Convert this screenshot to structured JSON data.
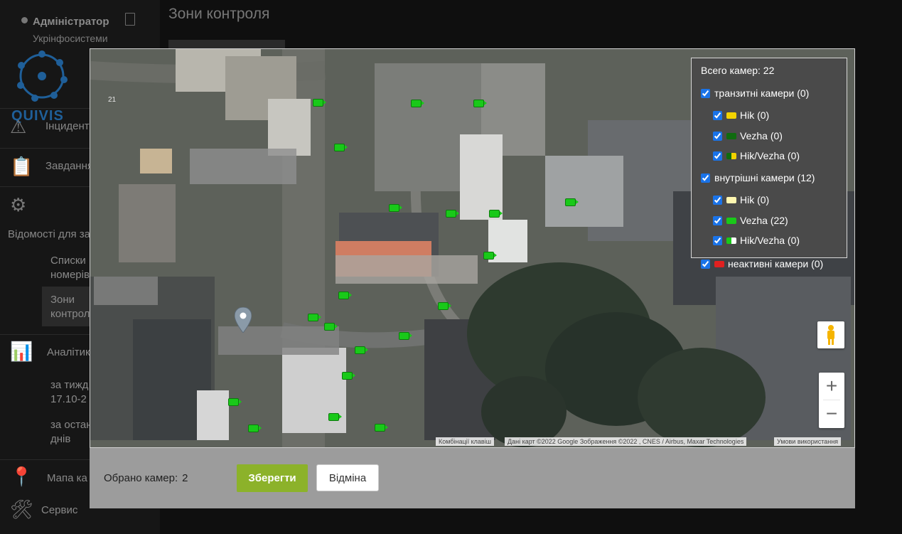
{
  "sidebar": {
    "user_name": "Адміністратор",
    "org_name": "Укрінфосистеми",
    "logo_text": "QUIVIS",
    "items": [
      {
        "label": "Інциденти"
      },
      {
        "label": "Завдання"
      },
      {
        "label": "Відомості для за"
      },
      {
        "label": "Аналітика"
      },
      {
        "label": "Мапа ка"
      },
      {
        "label": "Сервис"
      }
    ],
    "sub_items": [
      {
        "line1": "Списки",
        "line2": "номерів"
      },
      {
        "line1": "Зони",
        "line2": "контролю"
      },
      {
        "line1": "за тижд",
        "line2": "17.10-2"
      },
      {
        "line1": "за остан",
        "line2": "днів"
      }
    ]
  },
  "main": {
    "title": "Зони контроля"
  },
  "map": {
    "marker_label": "21",
    "legend": {
      "total_label": "Всего камер: 22",
      "groups": [
        {
          "label": "транзитні камери (0)",
          "checked": true,
          "items": [
            {
              "label": "Hik (0)",
              "color": "#f2d200",
              "checked": true
            },
            {
              "label": "Vezha (0)",
              "color": "#0f6b0f",
              "checked": true
            },
            {
              "label": "Hik/Vezha (0)",
              "color_a": "#0f6b0f",
              "color_b": "#f2d200",
              "checked": true
            }
          ]
        },
        {
          "label": "внутрішні камери (12)",
          "checked": true,
          "items": [
            {
              "label": "Hik (0)",
              "color": "#fff7b0",
              "checked": true
            },
            {
              "label": "Vezha (22)",
              "color": "#19c919",
              "checked": true
            },
            {
              "label": "Hik/Vezha (0)",
              "color_a": "#19c919",
              "color_b": "#ffffff",
              "checked": true
            }
          ]
        },
        {
          "label": "неактивні камери (0)",
          "color": "#e02020",
          "checked": true,
          "items": []
        }
      ]
    },
    "attribution": {
      "shortcuts": "Комбінації клавіш",
      "data": "Дані карт ©2022 Google Зображення ©2022 , CNES / Airbus, Maxar Technologies",
      "terms": "Умови використання"
    }
  },
  "footer": {
    "selected_label": "Обрано камер:",
    "selected_count": "2",
    "save_label": "Зберегти",
    "cancel_label": "Відміна"
  }
}
